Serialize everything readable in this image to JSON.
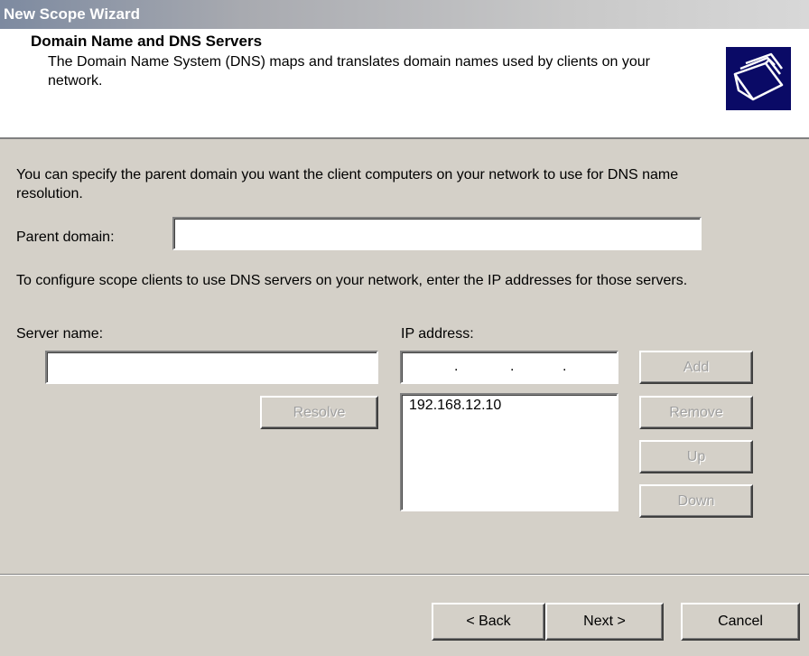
{
  "window": {
    "title": "New Scope Wizard"
  },
  "header": {
    "title": "Domain Name and DNS Servers",
    "description": "The Domain Name System (DNS) maps and translates domain names used by clients on your network.",
    "icon": "folders-icon"
  },
  "body": {
    "intro": "You can specify the parent domain you want the client computers on your network to use for DNS name resolution.",
    "parent_domain_label": "Parent domain:",
    "parent_domain_value": "",
    "dns_intro": "To configure scope clients to use DNS servers on your network, enter the IP addresses for those servers.",
    "server_name_label": "Server name:",
    "server_name_value": "",
    "ip_address_label": "IP address:",
    "ip_list": [
      "192.168.12.10"
    ]
  },
  "buttons": {
    "add": "Add",
    "resolve": "Resolve",
    "remove": "Remove",
    "up": "Up",
    "down": "Down",
    "back": "< Back",
    "next": "Next >",
    "cancel": "Cancel"
  }
}
